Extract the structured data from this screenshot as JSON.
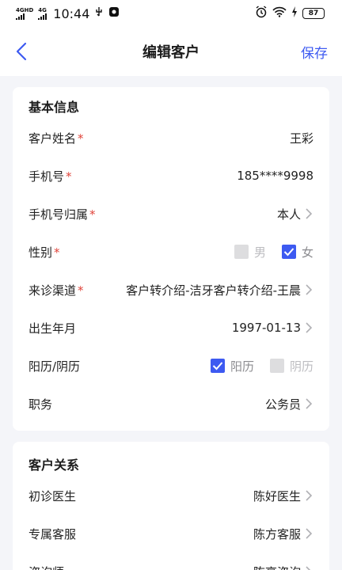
{
  "status_bar": {
    "network1": "4GHD",
    "network2": "4G",
    "time": "10:44",
    "battery": "87"
  },
  "nav": {
    "title": "编辑客户",
    "save_label": "保存"
  },
  "basic_section": {
    "title": "基本信息",
    "rows": [
      {
        "label": "客户姓名",
        "required": "*",
        "value": "王彩"
      },
      {
        "label": "手机号",
        "required": "*",
        "value": "185****9998"
      },
      {
        "label": "手机号归属",
        "required": "*",
        "value": "本人"
      },
      {
        "label": "性别",
        "required": "*",
        "options": [
          "男",
          "女"
        ],
        "selected": "女"
      },
      {
        "label": "来诊渠道",
        "required": "*",
        "value": "客户转介绍-洁牙客户转介绍-王晨"
      },
      {
        "label": "出生年月",
        "value": "1997-01-13"
      },
      {
        "label": "阳历/阴历",
        "options": [
          "阳历",
          "阴历"
        ],
        "selected": "阳历"
      },
      {
        "label": "职务",
        "value": "公务员"
      }
    ]
  },
  "relation_section": {
    "title": "客户关系",
    "rows": [
      {
        "label": "初诊医生",
        "value": "陈好医生"
      },
      {
        "label": "专属客服",
        "value": "陈方客服"
      },
      {
        "label": "咨询师",
        "value": "陈亮咨询"
      }
    ]
  },
  "colors": {
    "accent": "#3d5af1",
    "required": "#e0443a",
    "background": "#f4f5f9"
  }
}
